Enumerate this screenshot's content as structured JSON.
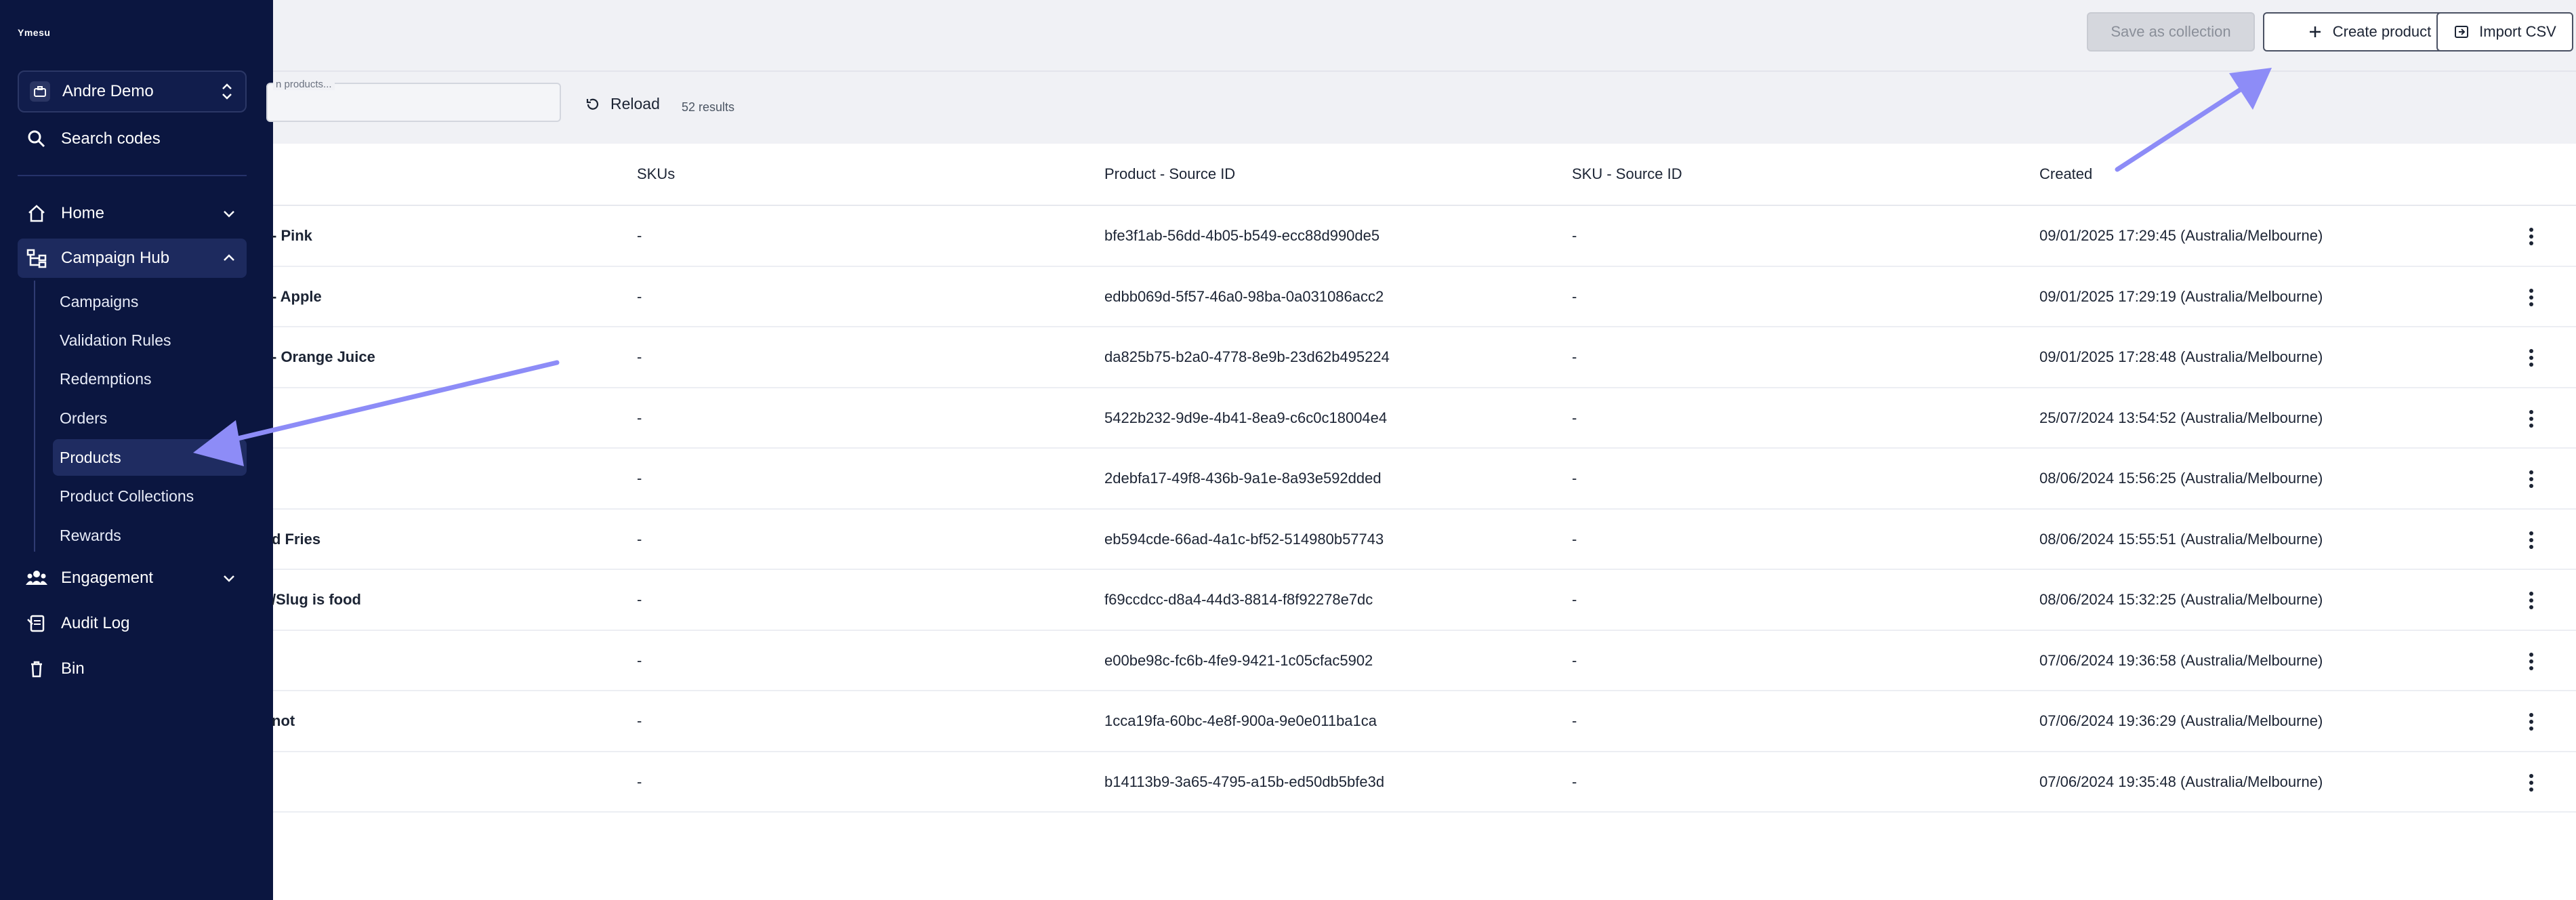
{
  "sidebar": {
    "logo": "Ymesu",
    "workspace": "Andre Demo",
    "search_codes": "Search codes",
    "nav": [
      {
        "label": "Home"
      },
      {
        "label": "Campaign Hub"
      },
      {
        "label": "Engagement"
      },
      {
        "label": "Audit Log"
      },
      {
        "label": "Bin"
      }
    ],
    "campaign_hub_items": [
      {
        "label": "Campaigns"
      },
      {
        "label": "Validation Rules"
      },
      {
        "label": "Redemptions"
      },
      {
        "label": "Orders"
      },
      {
        "label": "Products"
      },
      {
        "label": "Product Collections"
      },
      {
        "label": "Rewards"
      }
    ]
  },
  "toolbar": {
    "save_collection": "Save as collection",
    "create_product": "Create product",
    "import_csv": "Import CSV"
  },
  "filter": {
    "search_placeholder": "n products...",
    "reload": "Reload",
    "results": "52 results"
  },
  "table": {
    "headers": {
      "skus": "SKUs",
      "product_source_id": "Product - Source ID",
      "sku_source_id": "SKU - Source ID",
      "created": "Created"
    },
    "rows": [
      {
        "name": "- Pink",
        "skus": "-",
        "pid": "bfe3f1ab-56dd-4b05-b549-ecc88d990de5",
        "skuid": "-",
        "created": "09/01/2025 17:29:45 (Australia/Melbourne)"
      },
      {
        "name": "- Apple",
        "skus": "-",
        "pid": "edbb069d-5f57-46a0-98ba-0a031086acc2",
        "skuid": "-",
        "created": "09/01/2025 17:29:19 (Australia/Melbourne)"
      },
      {
        "name": "- Orange Juice",
        "skus": "-",
        "pid": "da825b75-b2a0-4778-8e9b-23d62b495224",
        "skuid": "-",
        "created": "09/01/2025 17:28:48 (Australia/Melbourne)"
      },
      {
        "name": "",
        "skus": "-",
        "pid": "5422b232-9d9e-4b41-8ea9-c6c0c18004e4",
        "skuid": "-",
        "created": "25/07/2024 13:54:52 (Australia/Melbourne)"
      },
      {
        "name": "",
        "skus": "-",
        "pid": "2debfa17-49f8-436b-9a1e-8a93e592dded",
        "skuid": "-",
        "created": "08/06/2024 15:56:25 (Australia/Melbourne)"
      },
      {
        "name": "d Fries",
        "skus": "-",
        "pid": "eb594cde-66ad-4a1c-bf52-514980b57743",
        "skuid": "-",
        "created": "08/06/2024 15:55:51 (Australia/Melbourne)"
      },
      {
        "name": "/Slug is food",
        "skus": "-",
        "pid": "f69ccdcc-d8a4-44d3-8814-f8f92278e7dc",
        "skuid": "-",
        "created": "08/06/2024 15:32:25 (Australia/Melbourne)"
      },
      {
        "name": "",
        "skus": "-",
        "pid": "e00be98c-fc6b-4fe9-9421-1c05cfac5902",
        "skuid": "-",
        "created": "07/06/2024 19:36:58 (Australia/Melbourne)"
      },
      {
        "name": "not",
        "skus": "-",
        "pid": "1cca19fa-60bc-4e8f-900a-9e0e011ba1ca",
        "skuid": "-",
        "created": "07/06/2024 19:36:29 (Australia/Melbourne)"
      },
      {
        "name": "",
        "skus": "-",
        "pid": "b14113b9-3a65-4795-a15b-ed50db5bfe3d",
        "skuid": "-",
        "created": "07/06/2024 19:35:48 (Australia/Melbourne)"
      }
    ]
  },
  "colors": {
    "sidebar_bg": "#0b1640",
    "annotation_arrow": "#8d8cf7"
  }
}
